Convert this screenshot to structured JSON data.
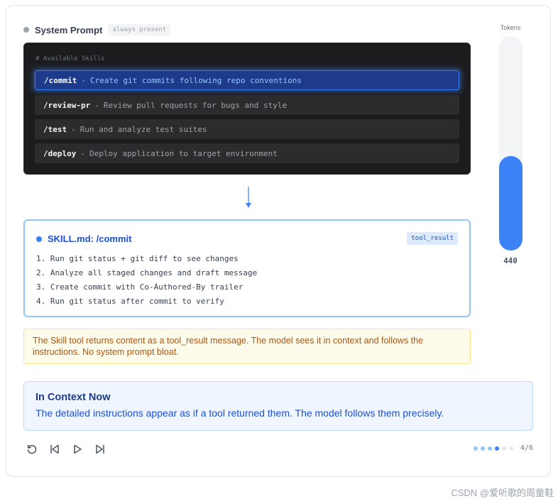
{
  "system_prompt": {
    "title": "System Prompt",
    "badge": "always present"
  },
  "skills": {
    "comment": "# Available Skills",
    "items": [
      {
        "cmd": "/commit",
        "sep": "-",
        "desc": "Create git commits following repo conventions",
        "active": true
      },
      {
        "cmd": "/review-pr",
        "sep": "-",
        "desc": "Review pull requests for bugs and style",
        "active": false
      },
      {
        "cmd": "/test",
        "sep": "-",
        "desc": "Run and analyze test suites",
        "active": false
      },
      {
        "cmd": "/deploy",
        "sep": "-",
        "desc": "Deploy application to target environment",
        "active": false
      }
    ]
  },
  "skill_md": {
    "title": "SKILL.md: /commit",
    "badge": "tool_result",
    "steps": [
      "1. Run git status + git diff to see changes",
      "2. Analyze all staged changes and draft message",
      "3. Create commit with Co-Authored-By trailer",
      "4. Run git status after commit to verify"
    ]
  },
  "note": "The Skill tool returns content as a tool_result message. The model sees it in context and follows the instructions. No system prompt bloat.",
  "context": {
    "title": "In Context Now",
    "body": "The detailed instructions appear as if a tool returned them. The model follows them precisely."
  },
  "controls": {
    "icons": [
      "restart-icon",
      "skip-back-icon",
      "play-icon",
      "skip-forward-icon"
    ]
  },
  "pager": {
    "current": 4,
    "total": 6,
    "label": "4/6"
  },
  "tokens": {
    "label": "Tokens",
    "value": "440",
    "fill_fraction": 0.44
  },
  "colors": {
    "accent": "#3b82f6",
    "accent_dark": "#1d4ed8",
    "note_text": "#b45309",
    "panel_dark": "#1c1c1e"
  },
  "watermark": "CSDN @爱听歌的周童鞋"
}
